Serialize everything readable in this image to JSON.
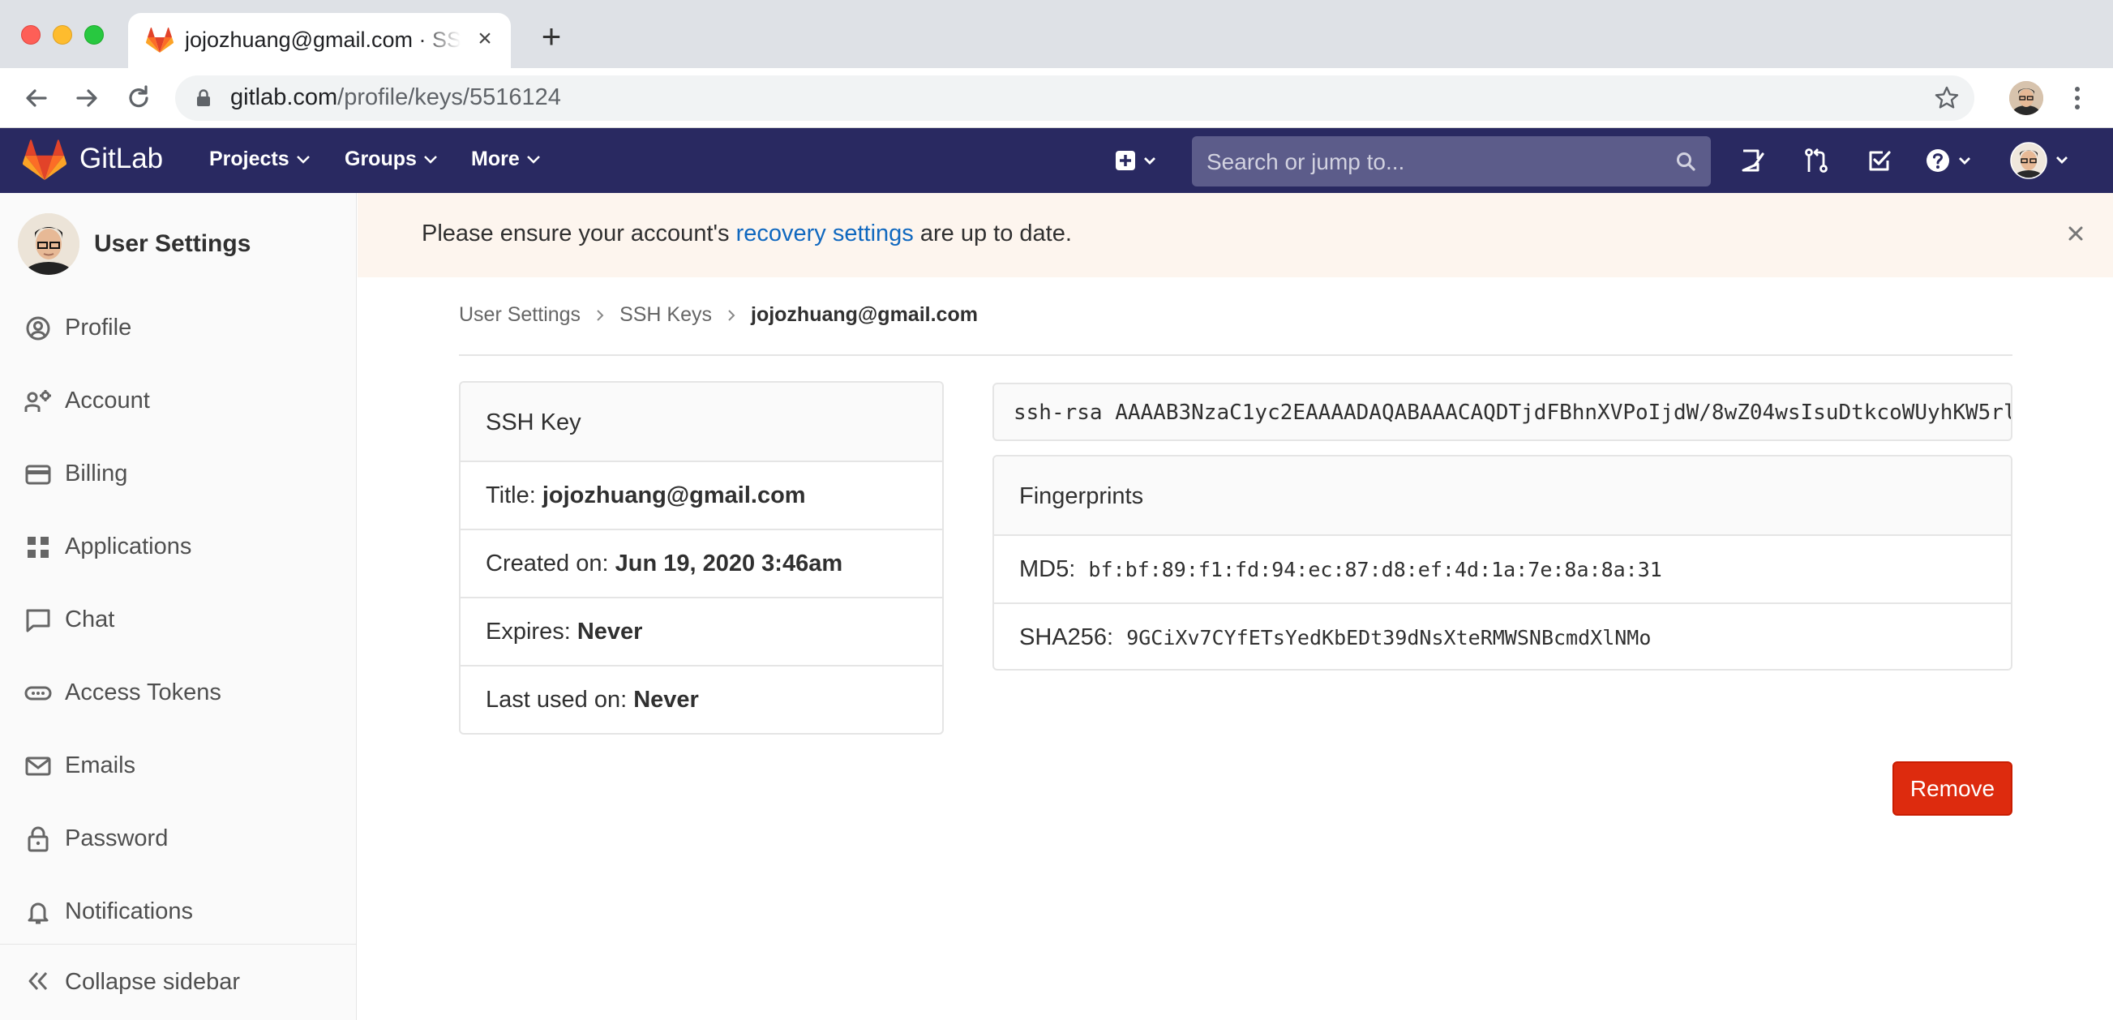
{
  "browser": {
    "tab_title": "jojozhuang@gmail.com · SSH Keys · User Settings · GitLab",
    "new_tab_icon": "plus-icon",
    "url_host": "gitlab.com",
    "url_path": "/profile/keys/5516124"
  },
  "navbar": {
    "brand": "GitLab",
    "menus": [
      "Projects",
      "Groups",
      "More"
    ],
    "search_placeholder": "Search or jump to...",
    "colors": {
      "background": "#292961",
      "search": "#5c5c8a"
    }
  },
  "sidebar": {
    "title": "User Settings",
    "items": [
      {
        "label": "Profile",
        "icon": "profile-icon"
      },
      {
        "label": "Account",
        "icon": "account-icon"
      },
      {
        "label": "Billing",
        "icon": "credit-card-icon"
      },
      {
        "label": "Applications",
        "icon": "applications-icon"
      },
      {
        "label": "Chat",
        "icon": "chat-icon"
      },
      {
        "label": "Access Tokens",
        "icon": "token-icon"
      },
      {
        "label": "Emails",
        "icon": "mail-icon"
      },
      {
        "label": "Password",
        "icon": "lock-icon"
      },
      {
        "label": "Notifications",
        "icon": "bell-icon"
      }
    ],
    "collapse_label": "Collapse sidebar"
  },
  "banner": {
    "before": "Please ensure your account's ",
    "link": "recovery settings",
    "after": " are up to date."
  },
  "breadcrumb": [
    "User Settings",
    "SSH Keys",
    "jojozhuang@gmail.com"
  ],
  "ssh_key": {
    "header": "SSH Key",
    "title_label": "Title:",
    "title_value": "jojozhuang@gmail.com",
    "created_label": "Created on:",
    "created_value": "Jun 19, 2020 3:46am",
    "expires_label": "Expires:",
    "expires_value": "Never",
    "last_used_label": "Last used on:",
    "last_used_value": "Never"
  },
  "public_key": "ssh-rsa AAAAB3NzaC1yc2EAAAADAQABAAACAQDTjdFBhnXVPoIjdW/8wZ04wsIsuDtkcoWUyhKW5rl",
  "fingerprints": {
    "header": "Fingerprints",
    "md5_label": "MD5:",
    "md5_value": "bf:bf:89:f1:fd:94:ec:87:d8:ef:4d:1a:7e:8a:8a:31",
    "sha256_label": "SHA256:",
    "sha256_value": "9GCiXv7CYfETsYedKbEDt39dNsXteRMWSNBcmdXlNMo"
  },
  "remove_label": "Remove",
  "accent": {
    "remove": "#dd2b0e",
    "link": "#1068bf"
  }
}
